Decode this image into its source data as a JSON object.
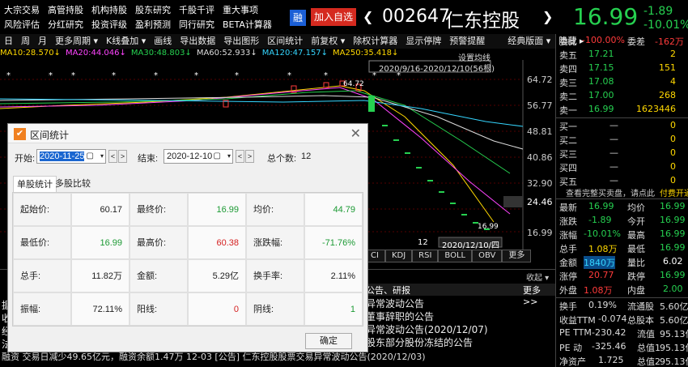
{
  "menu": {
    "row1": [
      "大宗交易",
      "高管持股",
      "机构持股",
      "股东研究",
      "千股千评",
      "重大事项"
    ],
    "row2": [
      "风险评估",
      "分红研究",
      "投资评级",
      "盈利预测",
      "同行研究",
      "BETA计算器"
    ]
  },
  "stock": {
    "rong_badge": "融",
    "add_watch": "加入自选",
    "code": "002647",
    "name": "仁东控股",
    "price": "16.99",
    "change": "-1.89",
    "change_pct": "-10.01%",
    "nav_left": "❮",
    "nav_right": "❯"
  },
  "toolbar": [
    "日",
    "周",
    "月",
    "更多周期 ▾",
    "K线叠加 ▾",
    "画线",
    "导出数据",
    "导出图形",
    "区间统计",
    "前复权 ▾",
    "除权计算器",
    "显示停牌",
    "预警提醒",
    "经典版面 ▾",
    "隐藏 ▸"
  ],
  "ma": [
    {
      "text": "MA10:28.570↓",
      "color": "#ffd800"
    },
    {
      "text": "MA20:44.046↓",
      "color": "#ff44ff"
    },
    {
      "text": "MA30:48.803↓",
      "color": "#26d050"
    },
    {
      "text": "MA60:52.933↓",
      "color": "#dddddd"
    },
    {
      "text": "MA120:47.157↓",
      "color": "#35d6ff"
    },
    {
      "text": "MA250:35.418↓",
      "color": "#ffd800"
    }
  ],
  "chart": {
    "price_axis": [
      "64.72",
      "56.77",
      "48.81",
      "40.86",
      "32.90",
      "24.46",
      "16.99"
    ],
    "highlight_price": "24.46",
    "peak_label": "64.72",
    "low_label": "16.99",
    "range_box": "2020/9/16-2020/12/10(56根)",
    "setting_btn": "设置均线",
    "date_label": "2020/12/10/四",
    "bottom_num": "12"
  },
  "indicator_tabs": [
    "CI",
    "KDJ",
    "RSI",
    "BOLL",
    "OBV",
    "更多"
  ],
  "news": {
    "header": "公告、研报",
    "more": "更多>>",
    "collapse": "收起 ▾",
    "left_frag": [
      "据",
      "收",
      "经",
      "法"
    ],
    "items": [
      "异常波动公告",
      "董事辞职的公告",
      "异常波动公告(2020/12/07)",
      "股东部分股份冻结的公告",
      "异常波动公告(2020/12/03)"
    ],
    "bottom_line": "融资 交易日减少49.65亿元，融资余额1.47万    12-03  [公告] 仁东控股股票交易异常波动公告(2020/12/03)"
  },
  "orderbook": {
    "weibi_label": "委比",
    "weibi_val": "-100.00%",
    "weicha_label": "委差",
    "weicha_val": "-162万",
    "sells": [
      {
        "label": "卖五",
        "price": "17.21",
        "vol": "2"
      },
      {
        "label": "卖四",
        "price": "17.15",
        "vol": "151"
      },
      {
        "label": "卖三",
        "price": "17.08",
        "vol": "4"
      },
      {
        "label": "卖二",
        "price": "17.00",
        "vol": "268"
      },
      {
        "label": "卖一",
        "price": "16.99",
        "vol": "1623446"
      }
    ],
    "buys": [
      {
        "label": "买一",
        "price": "—",
        "vol": "0"
      },
      {
        "label": "买二",
        "price": "—",
        "vol": "0"
      },
      {
        "label": "买三",
        "price": "—",
        "vol": "0"
      },
      {
        "label": "买四",
        "price": "—",
        "vol": "0"
      },
      {
        "label": "买五",
        "price": "—",
        "vol": "0"
      }
    ],
    "promo": "查看完整买卖盘，请点此",
    "promo_link": "付费开通"
  },
  "quote": [
    {
      "l1": "最新",
      "v1": "16.99",
      "c1": "#26d050",
      "l2": "均价",
      "v2": "16.99",
      "c2": "#26d050"
    },
    {
      "l1": "涨跌",
      "v1": "-1.89",
      "c1": "#26d050",
      "l2": "今开",
      "v2": "16.99",
      "c2": "#26d050"
    },
    {
      "l1": "涨幅",
      "v1": "-10.01%",
      "c1": "#26d050",
      "l2": "最高",
      "v2": "16.99",
      "c2": "#26d050"
    },
    {
      "l1": "总手",
      "v1": "1.08万",
      "c1": "#ffd800",
      "l2": "最低",
      "v2": "16.99",
      "c2": "#26d050"
    },
    {
      "l1": "金额",
      "v1": "1840万",
      "c1": "#35d6ff",
      "l2": "量比",
      "v2": "6.02",
      "c2": "#ffffff"
    },
    {
      "l1": "涨停",
      "v1": "20.77",
      "c1": "#ff3b3b",
      "l2": "跌停",
      "v2": "16.99",
      "c2": "#26d050"
    },
    {
      "l1": "外盘",
      "v1": "1.08万",
      "c1": "#ff3b3b",
      "l2": "内盘",
      "v2": "2.00",
      "c2": "#26d050"
    }
  ],
  "finance": [
    {
      "l1": "换手",
      "v1": "0.19%",
      "l2": "流通股",
      "v2": "5.60亿"
    },
    {
      "l1": "收益TTM",
      "v1": "-0.074",
      "l2": "总股本",
      "v2": "5.60亿"
    },
    {
      "l1": "PE TTM",
      "v1": "-230.42",
      "l2": "流值",
      "v2": "95.13亿"
    },
    {
      "l1": "PE 动",
      "v1": "-325.46",
      "l2": "总值1",
      "v2": "95.13亿"
    },
    {
      "l1": "净资产",
      "v1": "1.725",
      "l2": "总值2",
      "v2": "95.13亿"
    }
  ],
  "dialog": {
    "title": "区间统计",
    "start_label": "开始:",
    "start_date": "2020-11-25",
    "end_label": "结束:",
    "end_date": "2020-12-10",
    "count_label": "总个数:",
    "count": "12",
    "tab1": "单股统计",
    "tab2": "多股比较",
    "ok": "确定",
    "stats": [
      [
        {
          "label": "起始价:",
          "value": "60.17",
          "color": "#222222"
        },
        {
          "label": "最终价:",
          "value": "16.99",
          "color": "#1c9a34"
        },
        {
          "label": "均价:",
          "value": "44.79",
          "color": "#1c9a34"
        }
      ],
      [
        {
          "label": "最低价:",
          "value": "16.99",
          "color": "#1c9a34"
        },
        {
          "label": "最高价:",
          "value": "60.38",
          "color": "#d42020"
        },
        {
          "label": "涨跌幅:",
          "value": "-71.76%",
          "color": "#1c9a34"
        }
      ],
      [
        {
          "label": "总手:",
          "value": "11.82万",
          "color": "#222222"
        },
        {
          "label": "金额:",
          "value": "5.29亿",
          "color": "#222222"
        },
        {
          "label": "换手率:",
          "value": "2.11%",
          "color": "#222222"
        }
      ],
      [
        {
          "label": "振幅:",
          "value": "72.11%",
          "color": "#222222"
        },
        {
          "label": "阳线:",
          "value": "0",
          "color": "#d42020"
        },
        {
          "label": "阴线:",
          "value": "1",
          "color": "#1c9a34"
        }
      ]
    ]
  }
}
